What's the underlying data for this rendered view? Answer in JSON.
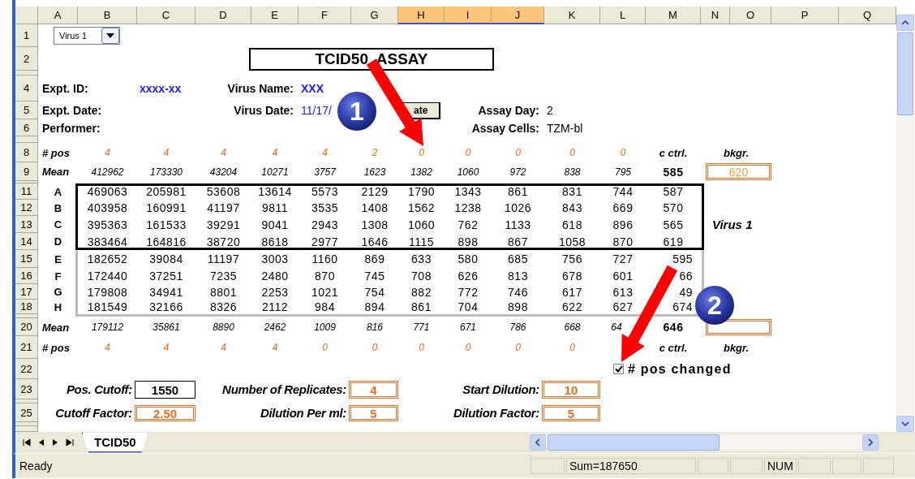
{
  "columns": [
    {
      "label": "A",
      "selected": false
    },
    {
      "label": "B",
      "selected": false
    },
    {
      "label": "C",
      "selected": false
    },
    {
      "label": "D",
      "selected": false
    },
    {
      "label": "E",
      "selected": false
    },
    {
      "label": "F",
      "selected": false
    },
    {
      "label": "G",
      "selected": false
    },
    {
      "label": "H",
      "selected": true
    },
    {
      "label": "I",
      "selected": true
    },
    {
      "label": "J",
      "selected": true
    },
    {
      "label": "K",
      "selected": false
    },
    {
      "label": "L",
      "selected": false
    },
    {
      "label": "M",
      "selected": false
    },
    {
      "label": "N",
      "selected": false
    },
    {
      "label": "O",
      "selected": false
    },
    {
      "label": "P",
      "selected": false
    },
    {
      "label": "Q",
      "selected": false
    }
  ],
  "row_headers": [
    "1",
    "2",
    "4",
    "5",
    "6",
    "8",
    "9",
    "11",
    "12",
    "13",
    "14",
    "15",
    "16",
    "17",
    "18",
    "20",
    "21",
    "22",
    "23",
    "25"
  ],
  "virus_select": {
    "value": "Virus 1"
  },
  "title": "TCID50  ASSAY",
  "info": [
    {
      "label": "Expt. ID:",
      "value": "xxxx-xx",
      "kind": "entry_bold"
    },
    {
      "label": "Virus Name:",
      "value": "XXX",
      "kind": "entry_bold"
    },
    {
      "label": "Expt. Date:"
    },
    {
      "label": "Virus Date:",
      "value": "11/17/",
      "kind": "entry"
    },
    {
      "label": "Assay Day:",
      "value": "2",
      "kind": "plain"
    },
    {
      "label": "Performer:"
    },
    {
      "label": "Assay Cells:",
      "value": "TZM-bl",
      "kind": "plain"
    }
  ],
  "date_button": "ate",
  "top_summary": {
    "pos_label": "# pos",
    "pos_counts": [
      "4",
      "4",
      "4",
      "4",
      "4",
      "2",
      "0",
      "0",
      "0",
      "0",
      "0"
    ],
    "ctrl_label": "c ctrl.",
    "bkgr_label": "bkgr.",
    "mean_label": "Mean",
    "means": [
      "412962",
      "173330",
      "43204",
      "10271",
      "3757",
      "1623",
      "1382",
      "1060",
      "972",
      "838",
      "795"
    ],
    "ctrl_mean": "585",
    "bkgr_value": "620"
  },
  "upper_block": {
    "label": "Virus 1",
    "rows": [
      {
        "label": "A",
        "values": [
          "469063",
          "205981",
          "53608",
          "13614",
          "5573",
          "2129",
          "1790",
          "1343",
          "861",
          "831",
          "744",
          "587"
        ]
      },
      {
        "label": "B",
        "values": [
          "403958",
          "160991",
          "41197",
          "9811",
          "3535",
          "1408",
          "1562",
          "1238",
          "1026",
          "843",
          "669",
          "570"
        ]
      },
      {
        "label": "C",
        "values": [
          "395363",
          "161533",
          "39291",
          "9041",
          "2943",
          "1308",
          "1060",
          "762",
          "1133",
          "618",
          "896",
          "565"
        ]
      },
      {
        "label": "D",
        "values": [
          "383464",
          "164816",
          "38720",
          "8618",
          "2977",
          "1646",
          "1115",
          "898",
          "867",
          "1058",
          "870",
          "619"
        ]
      }
    ]
  },
  "lower_block": {
    "rows": [
      {
        "label": "E",
        "values": [
          "182652",
          "39084",
          "11197",
          "3003",
          "1160",
          "869",
          "633",
          "580",
          "685",
          "756",
          "727",
          "595"
        ]
      },
      {
        "label": "F",
        "values": [
          "172440",
          "37251",
          "7235",
          "2480",
          "870",
          "745",
          "708",
          "626",
          "813",
          "678",
          "601",
          "66"
        ]
      },
      {
        "label": "G",
        "values": [
          "179808",
          "34941",
          "8801",
          "2253",
          "1021",
          "754",
          "882",
          "772",
          "746",
          "617",
          "613",
          "49"
        ]
      },
      {
        "label": "H",
        "values": [
          "181549",
          "32166",
          "8326",
          "2112",
          "984",
          "894",
          "861",
          "704",
          "898",
          "622",
          "627",
          "674"
        ]
      }
    ]
  },
  "bottom_summary": {
    "mean_label": "Mean",
    "means": [
      "179112",
      "35861",
      "8890",
      "2462",
      "1009",
      "816",
      "771",
      "671",
      "786",
      "668",
      "64"
    ],
    "ctrl_mean": "646",
    "pos_label": "# pos",
    "pos_counts": [
      "4",
      "4",
      "4",
      "4",
      "0",
      "0",
      "0",
      "0",
      "0",
      "0"
    ],
    "ctrl_label": "c ctrl.",
    "bkgr_label": "bkgr."
  },
  "pos_changed": {
    "label": "# pos changed",
    "checked": true
  },
  "parameters": [
    {
      "label": "Pos. Cutoff:",
      "value": "1550",
      "kind": "plain"
    },
    {
      "label": "Number of Replicates:",
      "value": "4",
      "kind": "highlight"
    },
    {
      "label": "Start Dilution:",
      "value": "10",
      "kind": "highlight"
    },
    {
      "label": "Cutoff Factor:",
      "value": "2.50",
      "kind": "highlight"
    },
    {
      "label": "Dilution Per ml:",
      "value": "5",
      "kind": "highlight"
    },
    {
      "label": "Dilution Factor:",
      "value": "5",
      "kind": "highlight"
    }
  ],
  "callouts": [
    {
      "label": "1"
    },
    {
      "label": "2"
    }
  ],
  "sheet_tabs": [
    {
      "label": "TCID50",
      "selected": true
    }
  ],
  "status_bar": {
    "mode": "Ready",
    "sum": "Sum=187650",
    "num": "NUM"
  }
}
